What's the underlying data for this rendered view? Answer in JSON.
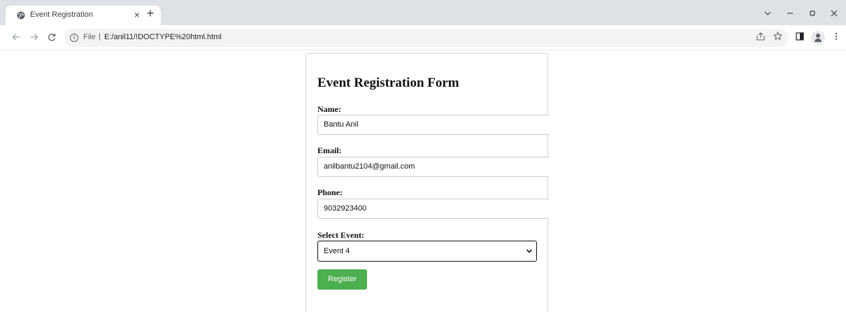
{
  "browser": {
    "tab_title": "Event Registration",
    "tab_close": "×",
    "new_tab": "+",
    "address": {
      "scheme_label": "File",
      "separator": "|",
      "url": "E:/anil11/!DOCTYPE%20html.html"
    },
    "icons": [
      "globe-icon",
      "close-icon",
      "plus-icon",
      "back-icon",
      "forward-icon",
      "reload-icon",
      "info-icon",
      "share-icon",
      "star-icon",
      "sidepanel-icon",
      "profile-icon",
      "menu-icon",
      "chevron-down-icon",
      "minimize-icon",
      "restore-icon",
      "close-window-icon"
    ]
  },
  "form": {
    "title": "Event Registration Form",
    "name_label": "Name:",
    "name_value": "Bantu Anil",
    "email_label": "Email:",
    "email_value": "anilbantu2104@gmail.com",
    "phone_label": "Phone:",
    "phone_value": "9032923400",
    "event_label": "Select Event:",
    "event_selected": "Event 4",
    "register_label": "Register"
  },
  "colors": {
    "register_button": "#4caf50",
    "tabstrip": "#dee1e6",
    "omnibox": "#f1f3f4"
  }
}
